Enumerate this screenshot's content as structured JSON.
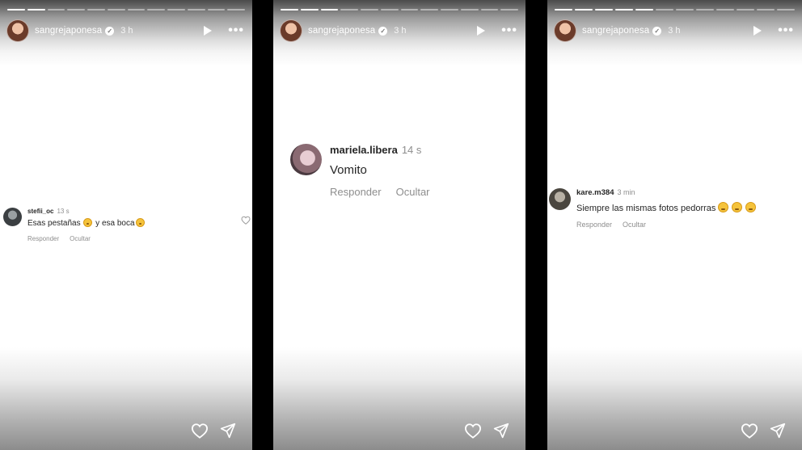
{
  "stories": [
    {
      "username": "sangrejaponesa",
      "time": "3 h",
      "progress_total": 12,
      "progress_done": 2,
      "comment": {
        "user": "stefii_oc",
        "time": "13 s",
        "text_before": "Esas pestañas",
        "text_middle": " y esa boca",
        "reply": "Responder",
        "hide": "Ocultar"
      }
    },
    {
      "username": "sangrejaponesa",
      "time": "3 h",
      "progress_total": 12,
      "progress_done": 3,
      "comment": {
        "user": "mariela.libera",
        "time": "14 s",
        "text": "Vomito",
        "reply": "Responder",
        "hide": "Ocultar"
      }
    },
    {
      "username": "sangrejaponesa",
      "time": "3 h",
      "progress_total": 12,
      "progress_done": 5,
      "comment": {
        "user": "kare.m384",
        "time": "3 min",
        "text": "Siempre las mismas fotos pedorras",
        "reply": "Responder",
        "hide": "Ocultar"
      }
    }
  ],
  "icons": {
    "verified": "verified-badge-icon",
    "play": "play-icon",
    "more": "more-options-icon",
    "heart": "heart-icon",
    "share": "send-icon",
    "emoji_story1": "laughing-emoji",
    "emoji_story3": "weary-face-emoji"
  }
}
